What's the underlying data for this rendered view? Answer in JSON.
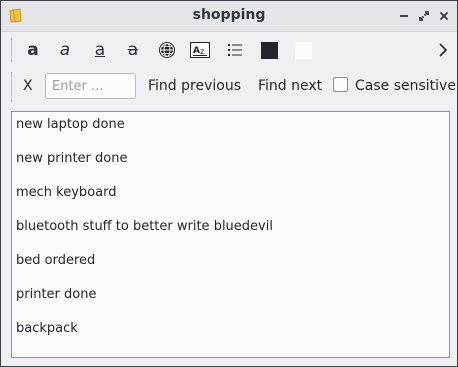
{
  "window": {
    "title": "shopping"
  },
  "titlebar_buttons": {
    "minimize": "minimize-icon",
    "restore": "restore-icon",
    "close": "close-icon"
  },
  "toolbar": {
    "tools": [
      {
        "name": "bold-button",
        "icon": "bold-a-icon",
        "glyph": "a"
      },
      {
        "name": "italic-button",
        "icon": "italic-a-icon",
        "glyph": "a"
      },
      {
        "name": "underline-button",
        "icon": "underline-a-icon",
        "glyph": "a"
      },
      {
        "name": "strikethrough-button",
        "icon": "strikethrough-a-icon",
        "glyph": "a"
      },
      {
        "name": "link-button",
        "icon": "globe-icon"
      },
      {
        "name": "check-spelling-button",
        "icon": "spellcheck-icon"
      },
      {
        "name": "bullet-list-button",
        "icon": "list-icon"
      },
      {
        "name": "text-color-button",
        "icon": "color-swatch-icon",
        "color": "#232629"
      },
      {
        "name": "background-color-button",
        "icon": "color-swatch-icon",
        "color": "#fcfcfc"
      }
    ],
    "overflow_icon": "chevron-right-icon"
  },
  "find": {
    "close_label": "X",
    "placeholder": "Enter ...",
    "value": "",
    "previous_label": "Find previous",
    "next_label": "Find next",
    "case_sensitive_label": "Case sensitive",
    "case_sensitive_checked": false
  },
  "note": {
    "lines": [
      "new laptop done",
      "new printer done",
      "mech keyboard",
      "bluetooth stuff to better write bluedevil",
      "bed ordered",
      "printer done",
      "backpack"
    ]
  },
  "colors": {
    "accent": "#3daee9",
    "window_bg": "#eff0f1",
    "editor_bg": "#fcfcfc",
    "text": "#232629"
  }
}
